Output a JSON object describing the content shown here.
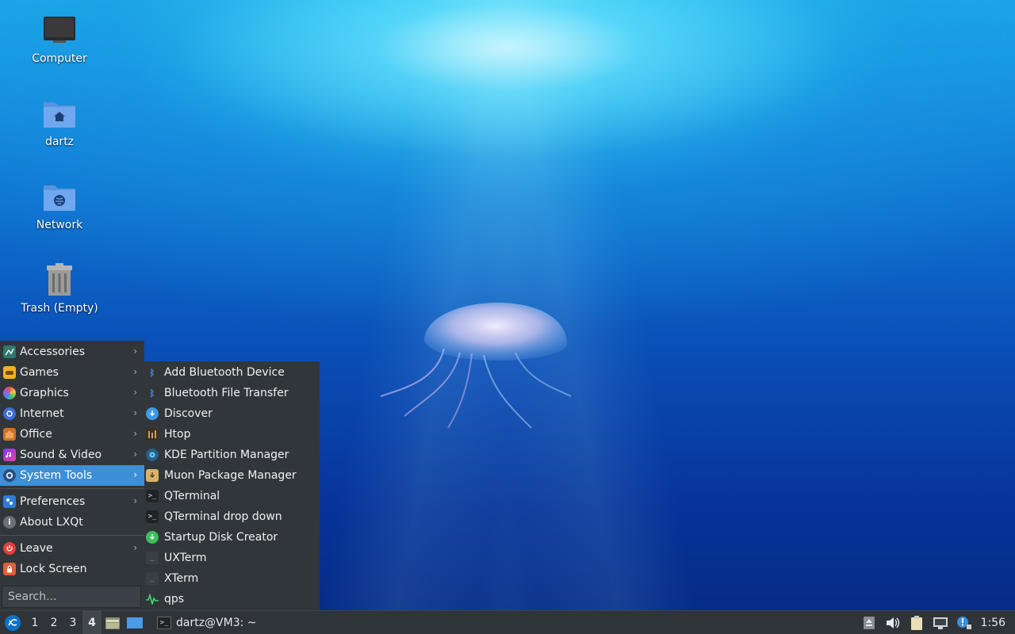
{
  "desktop": {
    "icons": [
      {
        "label": "Computer",
        "icon": "computer-icon"
      },
      {
        "label": "dartz",
        "icon": "home-folder-icon"
      },
      {
        "label": "Network",
        "icon": "network-folder-icon"
      },
      {
        "label": "Trash (Empty)",
        "icon": "trash-icon"
      }
    ]
  },
  "menu": {
    "categories": [
      {
        "label": "Accessories",
        "icon": "accessories-icon"
      },
      {
        "label": "Games",
        "icon": "games-icon"
      },
      {
        "label": "Graphics",
        "icon": "graphics-icon"
      },
      {
        "label": "Internet",
        "icon": "internet-icon"
      },
      {
        "label": "Office",
        "icon": "office-icon"
      },
      {
        "label": "Sound & Video",
        "icon": "sound-video-icon"
      },
      {
        "label": "System Tools",
        "icon": "system-tools-icon",
        "active": true
      }
    ],
    "preferences": {
      "label": "Preferences",
      "icon": "preferences-icon"
    },
    "about": {
      "label": "About LXQt",
      "icon": "info-icon"
    },
    "leave": {
      "label": "Leave",
      "icon": "power-icon"
    },
    "lock": {
      "label": "Lock Screen",
      "icon": "lock-icon"
    },
    "search_placeholder": "Search..."
  },
  "submenu": {
    "items": [
      {
        "label": "Add Bluetooth Device",
        "icon": "bluetooth-icon"
      },
      {
        "label": "Bluetooth File Transfer",
        "icon": "bluetooth-icon"
      },
      {
        "label": "Discover",
        "icon": "discover-icon"
      },
      {
        "label": "Htop",
        "icon": "htop-icon"
      },
      {
        "label": "KDE Partition Manager",
        "icon": "partition-manager-icon"
      },
      {
        "label": "Muon Package Manager",
        "icon": "package-manager-icon"
      },
      {
        "label": "QTerminal",
        "icon": "terminal-icon"
      },
      {
        "label": "QTerminal drop down",
        "icon": "terminal-icon"
      },
      {
        "label": "Startup Disk Creator",
        "icon": "startup-disk-icon"
      },
      {
        "label": "UXTerm",
        "icon": "xterm-icon"
      },
      {
        "label": "XTerm",
        "icon": "xterm-icon"
      },
      {
        "label": "qps",
        "icon": "qps-icon"
      }
    ]
  },
  "taskbar": {
    "desktops": [
      "1",
      "2",
      "3",
      "4"
    ],
    "current_desktop": "4",
    "task_label": "dartz@VM3: ~",
    "clock": "1:56"
  },
  "colors": {
    "menu_bg": "#31363b",
    "highlight": "#3d8fd6",
    "taskbar_bg": "#2f3439"
  }
}
